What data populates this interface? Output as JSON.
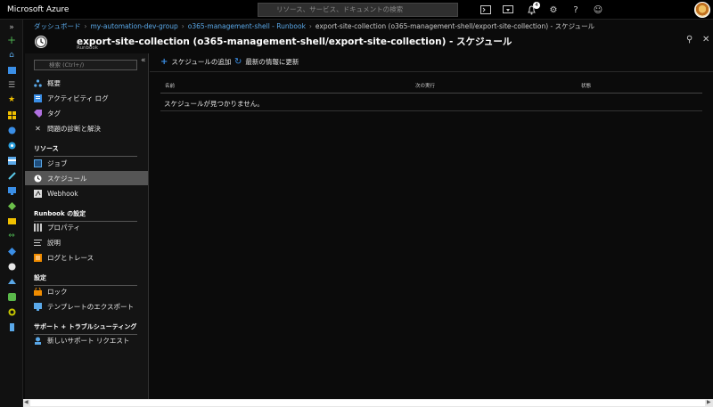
{
  "app": {
    "brand": "Microsoft Azure"
  },
  "search": {
    "placeholder": "リソース、サービス、ドキュメントの検索"
  },
  "topbar": {
    "notification_count": "4"
  },
  "breadcrumb": [
    "ダッシュボード",
    "my-automation-dev-group",
    "o365-management-shell - Runbook",
    "export-site-collection (o365-management-shell/export-site-collection) - スケジュール"
  ],
  "blade": {
    "title": "export-site-collection (o365-management-shell/export-site-collection) - スケジュール",
    "subtitle": "Runbook"
  },
  "sidebar": {
    "search_placeholder": "検索 (Ctrl+/)",
    "items_top": [
      {
        "label": "概要",
        "icon": "overview-icon"
      },
      {
        "label": "アクティビティ ログ",
        "icon": "activity-log-icon"
      },
      {
        "label": "タグ",
        "icon": "tag-icon"
      },
      {
        "label": "問題の診断と解決",
        "icon": "wrench-icon"
      }
    ],
    "section_resources": "リソース",
    "items_resources": [
      {
        "label": "ジョブ",
        "icon": "jobs-icon"
      },
      {
        "label": "スケジュール",
        "icon": "clock-icon"
      },
      {
        "label": "Webhook",
        "icon": "webhook-icon"
      }
    ],
    "section_runbook_settings": "Runbook の設定",
    "items_runbook_settings": [
      {
        "label": "プロパティ",
        "icon": "properties-icon"
      },
      {
        "label": "説明",
        "icon": "description-icon"
      },
      {
        "label": "ログとトレース",
        "icon": "logs-icon"
      }
    ],
    "section_settings": "設定",
    "items_settings": [
      {
        "label": "ロック",
        "icon": "lock-icon"
      },
      {
        "label": "テンプレートのエクスポート",
        "icon": "export-template-icon"
      }
    ],
    "section_support": "サポート + トラブルシューティング",
    "items_support": [
      {
        "label": "新しいサポート リクエスト",
        "icon": "support-request-icon"
      }
    ]
  },
  "toolbar": {
    "add_schedule": "スケジュールの追加",
    "refresh": "最新の情報に更新"
  },
  "table": {
    "columns": [
      "名前",
      "次の実行",
      "状態"
    ],
    "empty_message": "スケジュールが見つかりません。"
  },
  "colors": {
    "link": "#5aa8e8",
    "accent_blue": "#0078d4",
    "active_item": "#555555"
  }
}
